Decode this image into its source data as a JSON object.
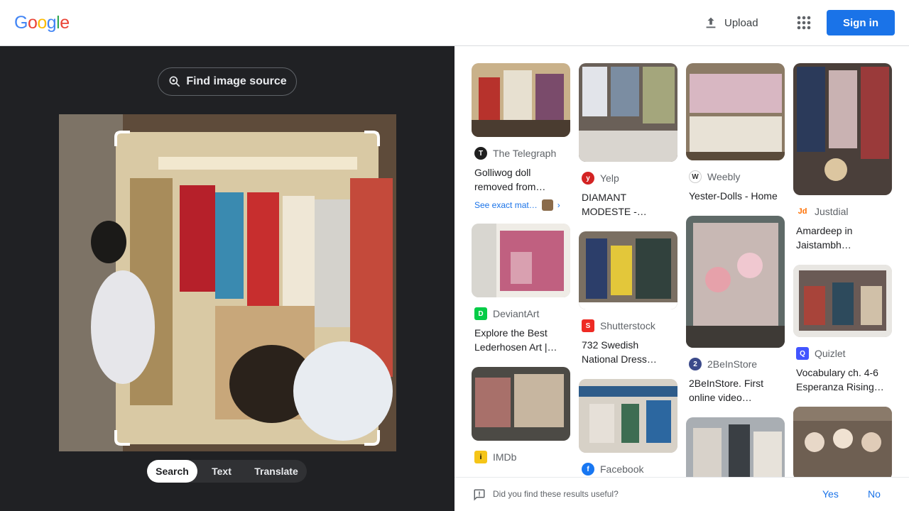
{
  "header": {
    "logo": [
      "G",
      "o",
      "o",
      "g",
      "l",
      "e"
    ],
    "upload_label": "Upload",
    "signin_label": "Sign in"
  },
  "left": {
    "find_source_label": "Find image source",
    "tabs": [
      "Search",
      "Text",
      "Translate"
    ]
  },
  "results": {
    "col1": [
      {
        "source": "The Telegraph",
        "title": "Golliwog doll removed from…",
        "exact": "See exact mat…"
      },
      {
        "source": "DeviantArt",
        "title": "Explore the Best Lederhosen Art |…"
      },
      {
        "source": "IMDb",
        "title": ""
      }
    ],
    "col2": [
      {
        "source": "Yelp",
        "title": "DIAMANT MODESTE -…"
      },
      {
        "source": "Shutterstock",
        "title": "732 Swedish National Dress…"
      },
      {
        "source": "Facebook",
        "title": ""
      }
    ],
    "col3": [
      {
        "source": "Weebly",
        "title": "Yester-Dolls - Home"
      },
      {
        "source": "2BeInStore",
        "title": "2BeInStore. First online video…"
      },
      {
        "source": "",
        "title": ""
      }
    ],
    "col4": [
      {
        "source": "Justdial",
        "title": "Amardeep in Jaistambh…"
      },
      {
        "source": "Quizlet",
        "title": "Vocabulary ch. 4-6 Esperanza Rising…"
      },
      {
        "source": "",
        "title": ""
      }
    ]
  },
  "feedback": {
    "question": "Did you find these results useful?",
    "yes": "Yes",
    "no": "No"
  },
  "colors": {
    "accent": "#1a73e8",
    "left_bg": "#202124",
    "logo": [
      "#4285f4",
      "#ea4335",
      "#fbbc05",
      "#4285f4",
      "#34a853",
      "#ea4335"
    ]
  }
}
